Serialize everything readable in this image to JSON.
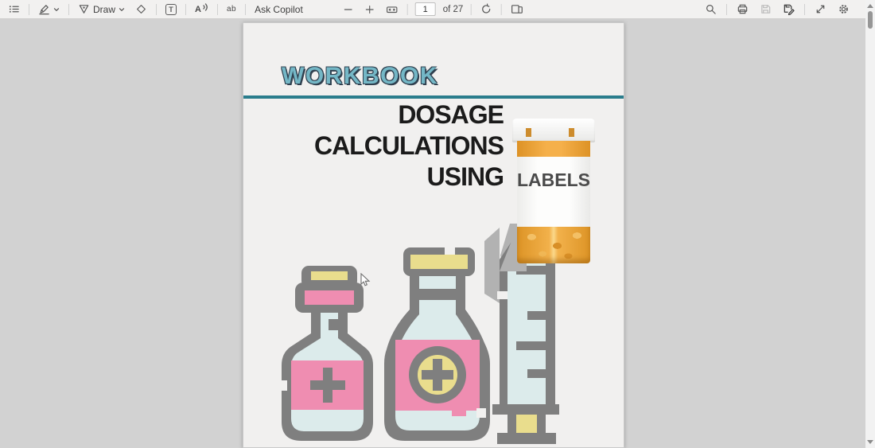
{
  "toolbar": {
    "draw_label": "Draw",
    "ask_copilot_label": "Ask Copilot",
    "page_number": "1",
    "page_count_label": "of 27",
    "textbox_glyph": "T",
    "read_aloud_glyph": "A",
    "translate_glyph": "ab",
    "icons": [
      "table-of-contents",
      "highlighter",
      "draw-pen",
      "eraser",
      "text-box",
      "read-aloud",
      "translate",
      "zoom-out",
      "zoom-in",
      "fit-to-width",
      "rotate",
      "page-view",
      "search",
      "print",
      "save",
      "save-as",
      "fullscreen",
      "settings"
    ]
  },
  "scrollbar": {
    "position": "top"
  },
  "page": {
    "workbook_title": "WORKBOOK",
    "heading_line1": "DOSAGE",
    "heading_line2": "CALCULATIONS",
    "heading_line3": "USING",
    "pill_bottle_label": "LABELS"
  },
  "colors": {
    "accent_teal": "#2a7d8c",
    "workbook_fill": "#74b7c6",
    "workbook_outline": "#30404f",
    "heading_text": "#1b1b1b",
    "illustration_outline": "#7f7f7f",
    "illustration_pink": "#ef8db1",
    "illustration_blue": "#dcebeb",
    "illustration_yellow": "#e9dd8d",
    "bottle_amber": "#eca438",
    "shadow_gray": "#b2b2b2"
  }
}
